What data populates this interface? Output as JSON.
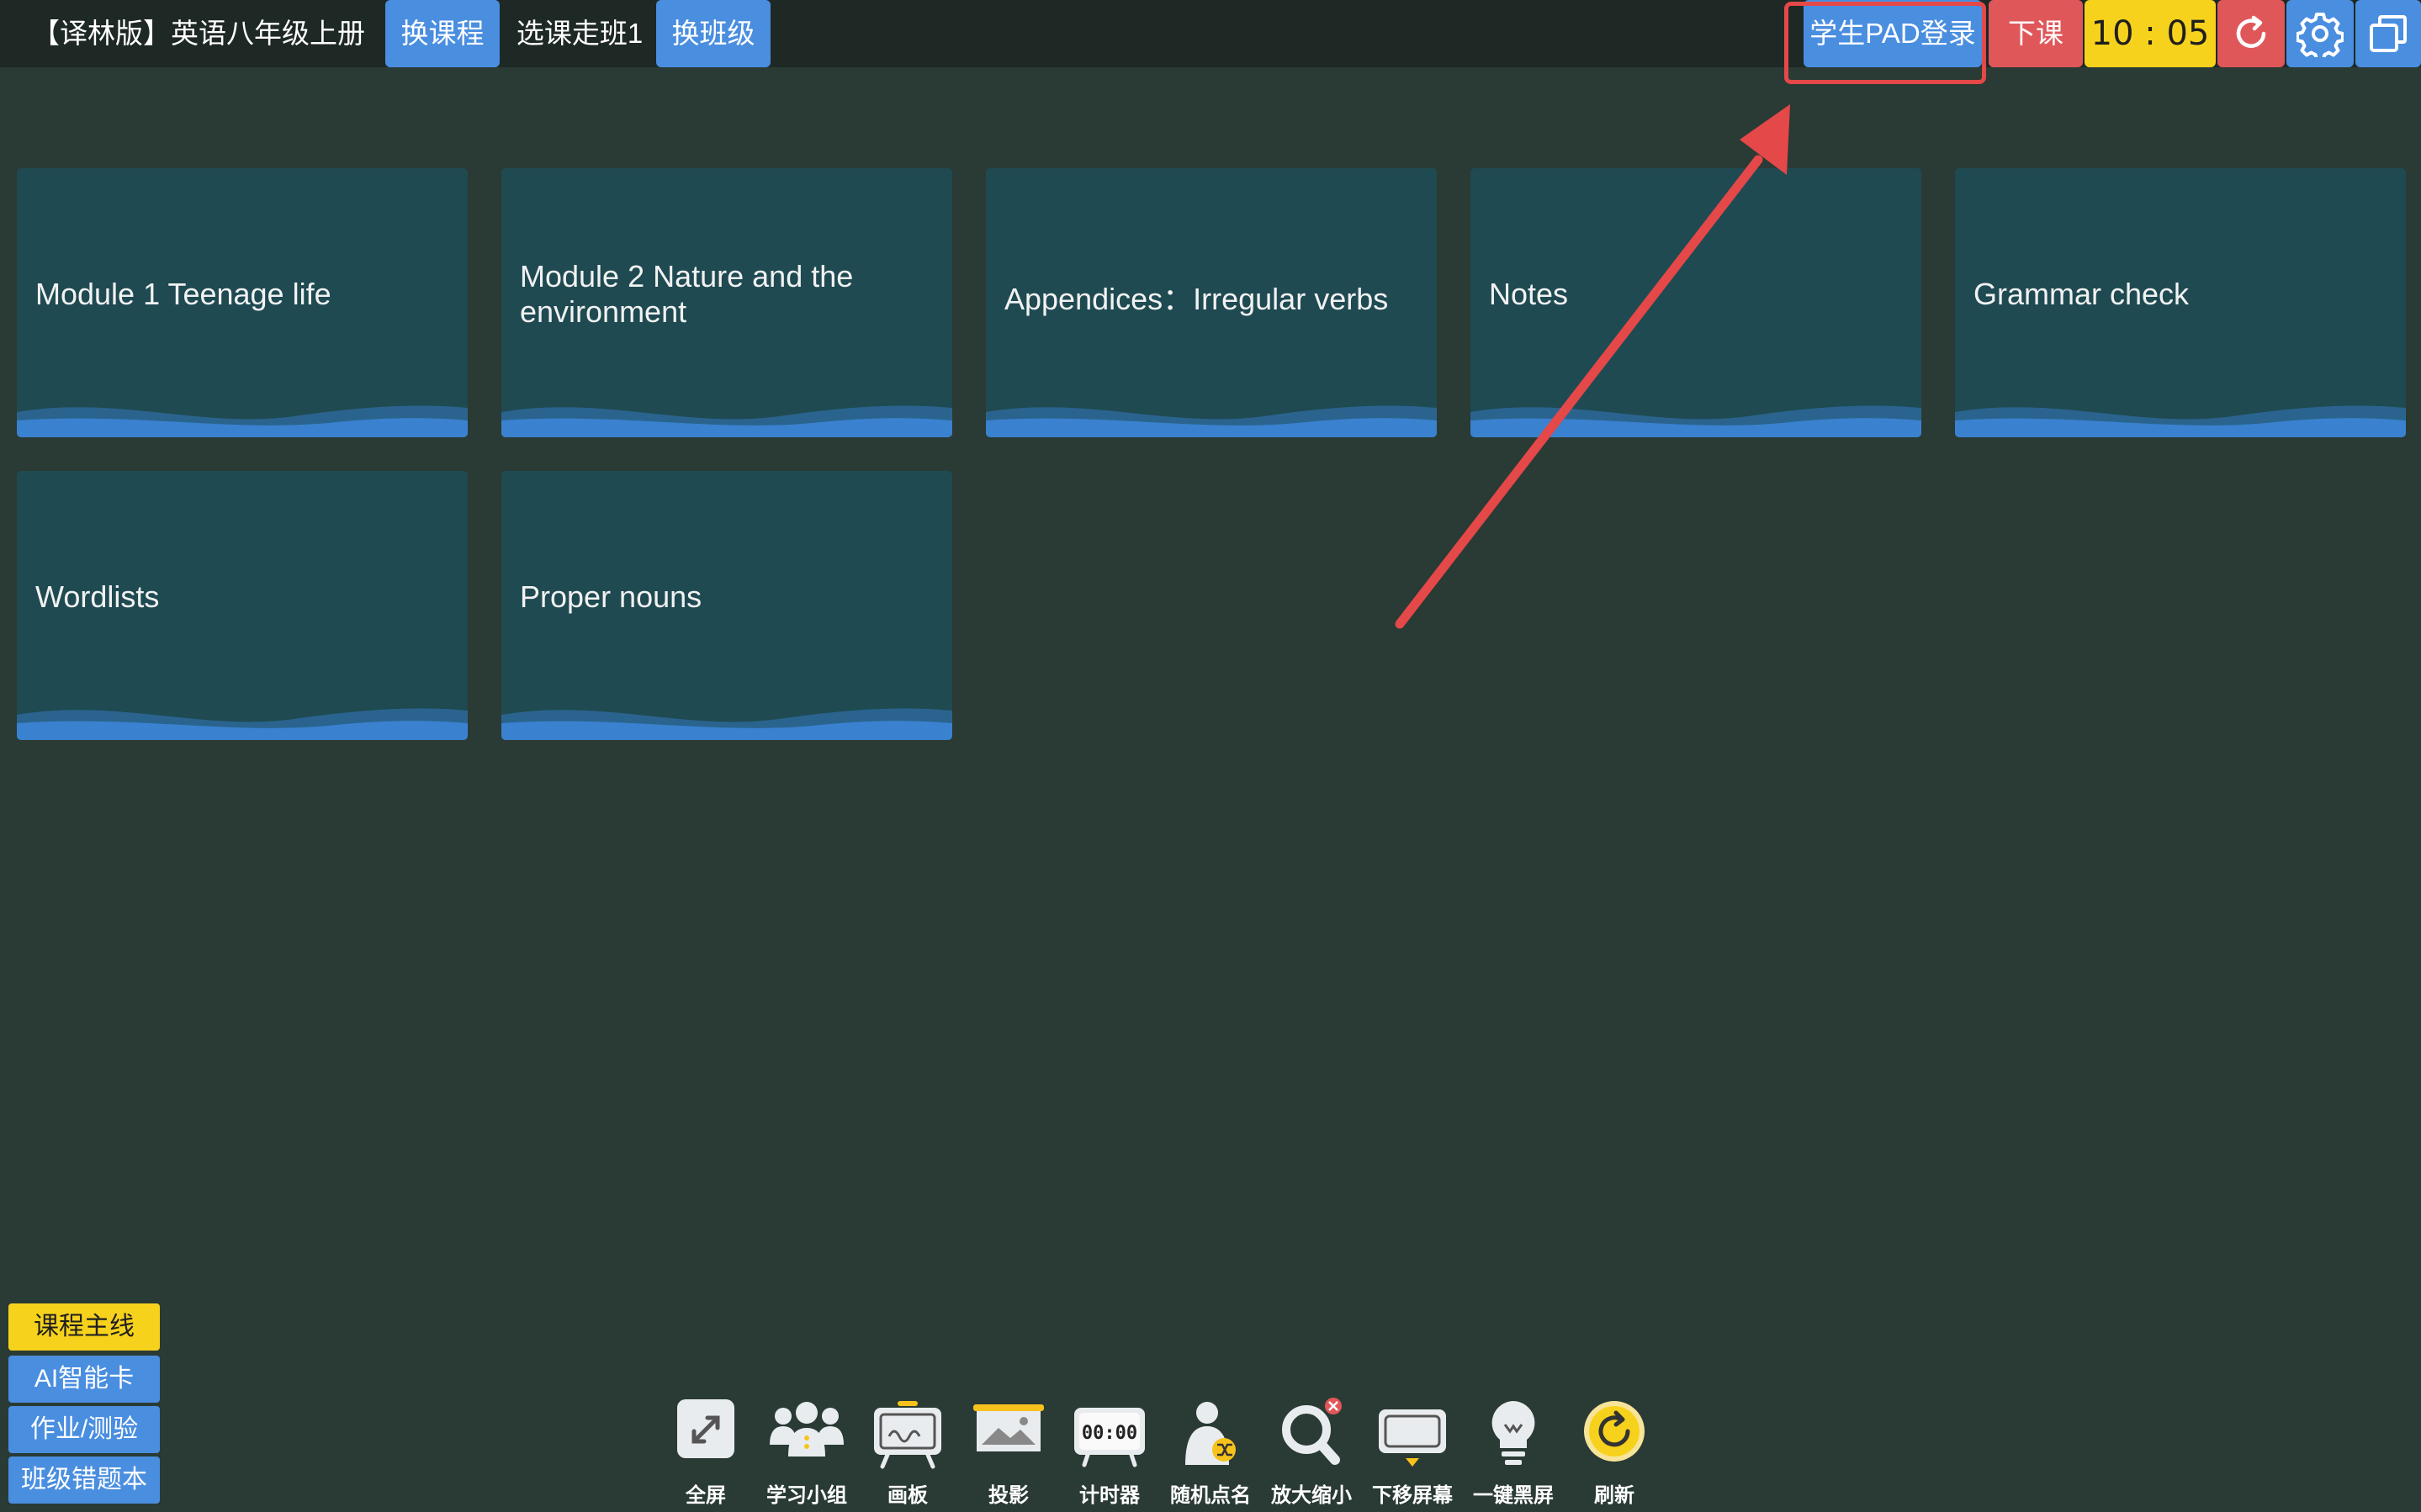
{
  "header": {
    "course_title": "【译林版】英语八年级上册",
    "change_course": "换课程",
    "class_name": "选课走班1",
    "change_class": "换班级",
    "student_pad_login": "学生PAD登录",
    "end_class": "下课",
    "clock": "10 : 05",
    "icons": [
      "refresh-icon",
      "gear-icon",
      "window-icon"
    ]
  },
  "cards": [
    {
      "title": "Module 1 Teenage life"
    },
    {
      "title": "Module 2 Nature and the environment"
    },
    {
      "title": "Appendices：Irregular verbs"
    },
    {
      "title": "Notes"
    },
    {
      "title": "Grammar check"
    },
    {
      "title": "Wordlists"
    },
    {
      "title": "Proper nouns"
    }
  ],
  "side_tabs": [
    {
      "label": "课程主线",
      "active": true
    },
    {
      "label": "AI智能卡",
      "active": false
    },
    {
      "label": "作业/测验",
      "active": false
    },
    {
      "label": "班级错题本",
      "active": false
    }
  ],
  "tools": [
    {
      "label": "全屏",
      "icon": "fullscreen-icon"
    },
    {
      "label": "学习小组",
      "icon": "group-icon"
    },
    {
      "label": "画板",
      "icon": "drawing-board-icon"
    },
    {
      "label": "投影",
      "icon": "projector-icon"
    },
    {
      "label": "计时器",
      "icon": "timer-icon",
      "display": "00:00"
    },
    {
      "label": "随机点名",
      "icon": "random-call-icon"
    },
    {
      "label": "放大缩小",
      "icon": "magnifier-icon"
    },
    {
      "label": "下移屏幕",
      "icon": "screen-down-icon"
    },
    {
      "label": "一键黑屏",
      "icon": "lightbulb-icon"
    },
    {
      "label": "刷新",
      "icon": "refresh-icon"
    }
  ],
  "colors": {
    "background": "#2a3a34",
    "topbar": "#1e2824",
    "card": "#1f4a52",
    "accent_blue": "#4a8ee0",
    "accent_red": "#e0575a",
    "accent_yellow": "#f7d21c",
    "annotation": "#e44848"
  }
}
